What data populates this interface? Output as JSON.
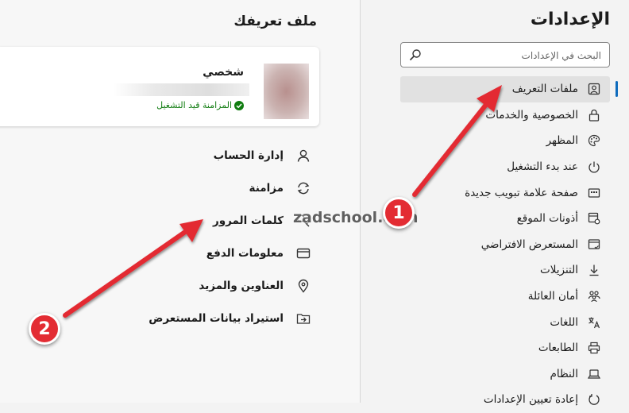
{
  "settings": {
    "title": "الإعدادات",
    "search_placeholder": "البحث في الإعدادات",
    "nav": [
      {
        "label": "ملفات التعريف",
        "icon": "profile-icon",
        "active": true
      },
      {
        "label": "الخصوصية والخدمات",
        "icon": "lock-icon"
      },
      {
        "label": "المظهر",
        "icon": "palette-icon"
      },
      {
        "label": "عند بدء التشغيل",
        "icon": "power-icon"
      },
      {
        "label": "صفحة علامة تبويب جديدة",
        "icon": "new-tab-icon"
      },
      {
        "label": "أذونات الموقع",
        "icon": "site-permissions-icon"
      },
      {
        "label": "المستعرض الافتراضي",
        "icon": "default-browser-icon"
      },
      {
        "label": "التنزيلات",
        "icon": "download-icon"
      },
      {
        "label": "أمان العائلة",
        "icon": "family-icon"
      },
      {
        "label": "اللغات",
        "icon": "languages-icon"
      },
      {
        "label": "الطابعات",
        "icon": "printer-icon"
      },
      {
        "label": "النظام",
        "icon": "laptop-icon"
      },
      {
        "label": "إعادة تعيين الإعدادات",
        "icon": "reset-icon"
      }
    ]
  },
  "profile": {
    "title": "ملف تعريفك",
    "name": "شخصي",
    "sync_status": "المزامنة قيد التشغيل",
    "menu": [
      {
        "label": "إدارة الحساب",
        "icon": "person-icon"
      },
      {
        "label": "مزامنة",
        "icon": "sync-icon"
      },
      {
        "label": "كلمات المرور",
        "icon": "key-icon"
      },
      {
        "label": "معلومات الدفع",
        "icon": "card-icon"
      },
      {
        "label": "العناوين والمزيد",
        "icon": "location-pin-icon"
      },
      {
        "label": "استيراد بيانات المستعرض",
        "icon": "import-folder-icon"
      }
    ]
  },
  "overlay": {
    "watermark": "zadschool.com",
    "badge_1": "1",
    "badge_2": "2",
    "accent_color": "#e32c33"
  },
  "colors": {
    "accent": "#0f6cbd",
    "sync_green": "#107c10"
  }
}
